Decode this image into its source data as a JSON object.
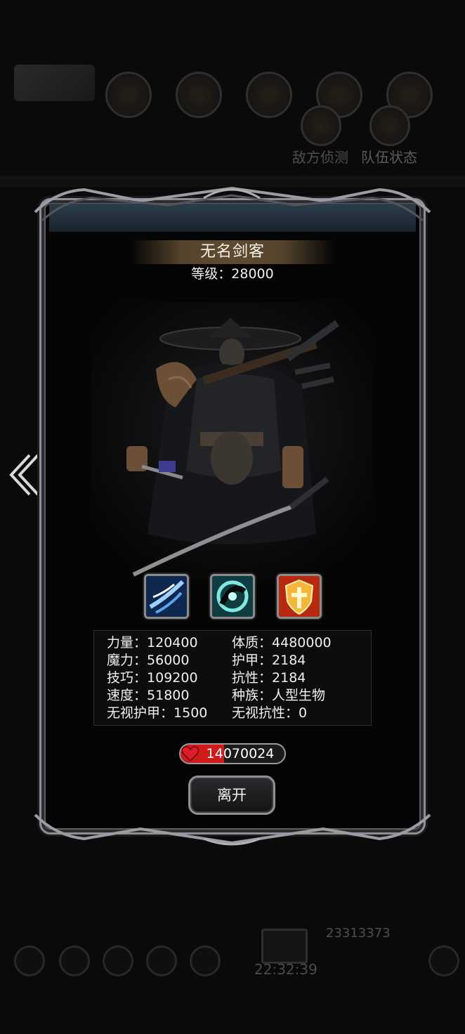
{
  "background": {
    "tabs": [
      "敌方侦测",
      "队伍状态"
    ],
    "clock": "22:32:39",
    "partial_number": "23313373"
  },
  "monster": {
    "name": "无名剑客",
    "level_label": "等级：",
    "level_value": "28000"
  },
  "skills": [
    {
      "icon": "wind-slash-skill-icon",
      "color": "#3a78d8"
    },
    {
      "icon": "cyclone-skill-icon",
      "color": "#2fb8b0"
    },
    {
      "icon": "holy-shield-skill-icon",
      "color": "#e8a21c"
    }
  ],
  "stats": {
    "left": [
      {
        "label": "力量",
        "value": "120400"
      },
      {
        "label": "魔力",
        "value": "56000"
      },
      {
        "label": "技巧",
        "value": "109200"
      },
      {
        "label": "速度",
        "value": "51800"
      },
      {
        "label": "无视护甲",
        "value": "1500"
      }
    ],
    "right": [
      {
        "label": "体质",
        "value": "4480000"
      },
      {
        "label": "护甲",
        "value": "2184"
      },
      {
        "label": "抗性",
        "value": "2184"
      },
      {
        "label": "种族",
        "value": "人型生物"
      },
      {
        "label": "无视抗性",
        "value": "0"
      }
    ]
  },
  "hp": {
    "value": "14070024",
    "fill_fraction": 0.42,
    "color": "#d11a1a"
  },
  "buttons": {
    "leave": "离开"
  }
}
